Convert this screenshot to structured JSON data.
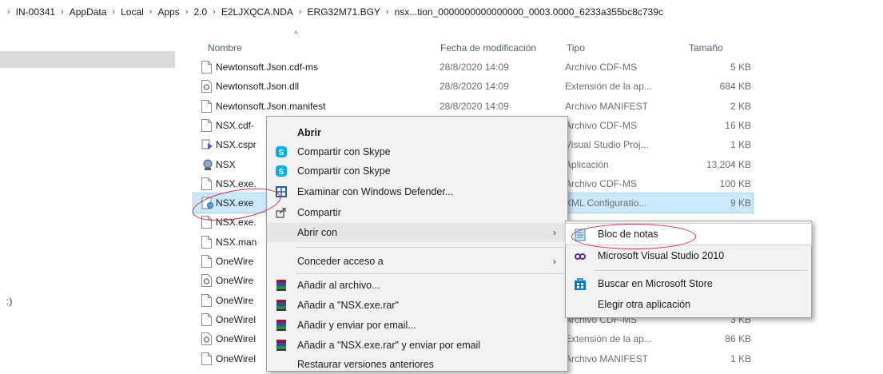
{
  "breadcrumb": {
    "items": [
      "IN-00341",
      "AppData",
      "Local",
      "Apps",
      "2.0",
      "E2LJXQCA.NDA",
      "ERG32M71.BGY",
      "nsx...tion_0000000000000000_0003.0000_6233a355bc8c739c"
    ],
    "separator": "›",
    "leading": "›"
  },
  "nav_pane": {
    "stub_text": ":)"
  },
  "columns": {
    "name": "Nombre",
    "date": "Fecha de modificación",
    "type": "Tipo",
    "size": "Tamaño",
    "sort_indicator": "^"
  },
  "files": [
    {
      "name": "Newtonsoft.Json.cdf-ms",
      "date": "28/8/2020 14:09",
      "type": "Archivo CDF-MS",
      "size": "5 KB",
      "icon": "file-icon"
    },
    {
      "name": "Newtonsoft.Json.dll",
      "date": "28/8/2020 14:09",
      "type": "Extensión de la ap...",
      "size": "684 KB",
      "icon": "dll-icon"
    },
    {
      "name": "Newtonsoft.Json.manifest",
      "date": "28/8/2020 14:09",
      "type": "Archivo MANIFEST",
      "size": "2 KB",
      "icon": "file-icon"
    },
    {
      "name": "NSX.cdf-",
      "date": "",
      "type": "Archivo CDF-MS",
      "size": "16 KB",
      "icon": "file-icon"
    },
    {
      "name": "NSX.cspr",
      "date": "",
      "type": "Visual Studio Proj...",
      "size": "1 KB",
      "icon": "csproj-icon"
    },
    {
      "name": "NSX",
      "date": "",
      "type": "Aplicación",
      "size": "13,204 KB",
      "icon": "app-icon"
    },
    {
      "name": "NSX.exe.",
      "date": "",
      "type": "Archivo CDF-MS",
      "size": "100 KB",
      "icon": "file-icon"
    },
    {
      "name": "NSX.exe",
      "date": "",
      "type": "XML Configuratio...",
      "size": "9 KB",
      "icon": "config-icon"
    },
    {
      "name": "NSX.exe.",
      "date": "",
      "type": "",
      "size": "",
      "icon": "file-icon"
    },
    {
      "name": "NSX.man",
      "date": "",
      "type": "",
      "size": "",
      "icon": "file-icon"
    },
    {
      "name": "OneWire",
      "date": "",
      "type": "",
      "size": "",
      "icon": "file-icon"
    },
    {
      "name": "OneWire",
      "date": "",
      "type": "",
      "size": "",
      "icon": "dll-icon"
    },
    {
      "name": "OneWire",
      "date": "",
      "type": "",
      "size": "",
      "icon": "file-icon"
    },
    {
      "name": "OneWirel",
      "date": "",
      "type": "Archivo CDF-MS",
      "size": "3 KB",
      "icon": "file-icon"
    },
    {
      "name": "OneWirel",
      "date": "",
      "type": "Extensión de la ap...",
      "size": "86 KB",
      "icon": "dll-icon"
    },
    {
      "name": "OneWirel",
      "date": "",
      "type": "Archivo MANIFEST",
      "size": "1 KB",
      "icon": "file-icon"
    }
  ],
  "context_menu": {
    "items": [
      {
        "label": "Abrir",
        "bold": true,
        "icon": ""
      },
      {
        "label": "Compartir con Skype",
        "icon": "skype-icon"
      },
      {
        "label": "Compartir con Skype",
        "icon": "skype-icon"
      },
      {
        "label": "Examinar con Windows Defender...",
        "icon": "defender-icon"
      },
      {
        "label": "Compartir",
        "icon": "share-icon"
      },
      {
        "label": "Abrir con",
        "icon": "",
        "submenu": true
      },
      {
        "label": "Conceder acceso a",
        "icon": "",
        "submenu": true
      },
      {
        "label": "Añadir al archivo...",
        "icon": "winrar-icon"
      },
      {
        "label": "Añadir a \"NSX.exe.rar\"",
        "icon": "winrar-icon"
      },
      {
        "label": "Añadir y enviar por email...",
        "icon": "winrar-icon"
      },
      {
        "label": "Añadir a \"NSX.exe.rar\" y enviar por email",
        "icon": "winrar-icon"
      },
      {
        "label": "Restaurar versiones anteriores",
        "icon": ""
      }
    ],
    "submenu_arrow": "›"
  },
  "submenu": {
    "items": [
      {
        "label": "Bloc de notas",
        "icon": "notepad-icon"
      },
      {
        "label": "Microsoft Visual Studio 2010",
        "icon": "visual-studio-icon"
      },
      {
        "label": "Buscar en Microsoft Store",
        "icon": "store-icon"
      },
      {
        "label": "Elegir otra aplicación",
        "icon": ""
      }
    ]
  },
  "colors": {
    "selection": "#cce8ff",
    "annotation": "#d7263d",
    "menu_bg": "#f2f2f2"
  }
}
